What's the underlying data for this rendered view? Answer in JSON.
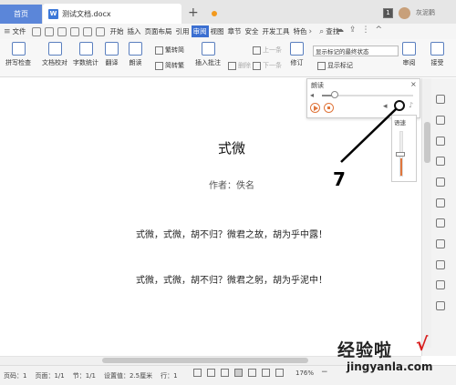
{
  "tabs": {
    "home": "首页",
    "doc": "测试文档.docx",
    "doc_icon": "W",
    "new_tab": "+"
  },
  "user": {
    "name": "灰泥鹳",
    "num_badge": "1"
  },
  "menu": {
    "file": "文件",
    "items": [
      "开始",
      "插入",
      "页面布局",
      "引用",
      "审阅",
      "视图",
      "章节",
      "安全",
      "开发工具",
      "特色"
    ],
    "active": "审阅",
    "search": "查找"
  },
  "ribbon": {
    "spellcheck": "拼写检查",
    "doc_check": "文档校对",
    "word_count": "字数统计",
    "translate": "翻译",
    "read_aloud": "朗读",
    "to_traditional": "繁转简",
    "to_simplified": "简转繁",
    "insert_comment": "插入批注",
    "delete": "删除",
    "prev": "上一条",
    "next": "下一条",
    "revise": "修订",
    "track_select": "显示标记的最终状态",
    "show_marks": "显示标记",
    "review": "审阅",
    "accept": "接受"
  },
  "document": {
    "title": "式微",
    "author": "作者：佚名",
    "lines": [
      "式微，式微，胡不归？微君之故，胡为乎中露！",
      "式微，式微，胡不归？微君之躬，胡为乎泥中！"
    ]
  },
  "read_panel": {
    "title": "朗读",
    "close": "×",
    "progress": 0.14
  },
  "speed_popup": {
    "label": "语速",
    "level": 0.4
  },
  "callout": "7",
  "status": {
    "page_code": "页码：1",
    "pages": "页面：1/1",
    "section": "节：1/1",
    "setting": "设置值：2.5厘米",
    "row": "行：1",
    "zoom": "176%",
    "zoom_minus": "−"
  },
  "watermark": {
    "cn": "经验啦",
    "check": "√",
    "url": "jingyanla.com"
  },
  "colors": {
    "accent": "#3b6fd1",
    "home_tab": "#5b86d9",
    "orange": "#e0763c"
  }
}
